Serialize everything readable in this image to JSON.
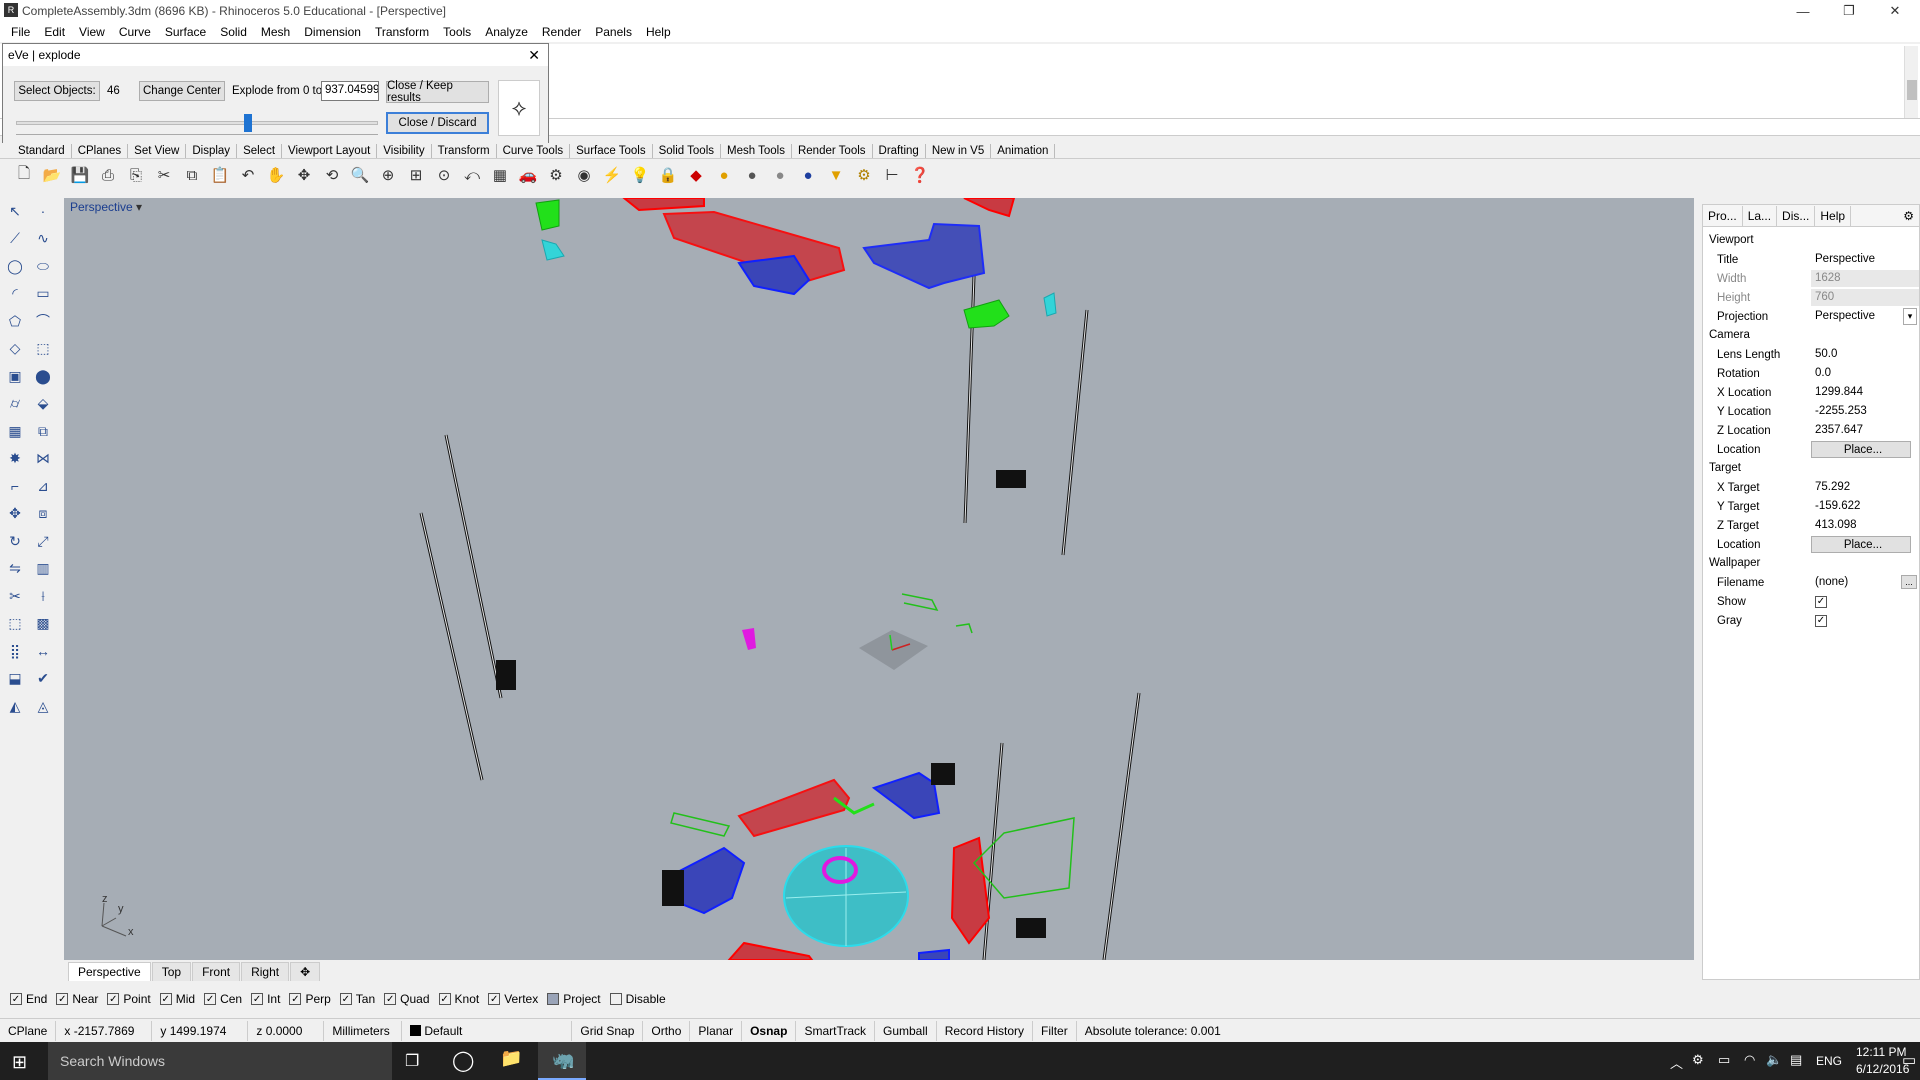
{
  "window": {
    "title": "CompleteAssembly.3dm (8696 KB) - Rhinoceros 5.0 Educational - [Perspective]",
    "minimize": "—",
    "maximize": "❐",
    "close": "✕"
  },
  "menu": [
    "File",
    "Edit",
    "View",
    "Curve",
    "Surface",
    "Solid",
    "Mesh",
    "Dimension",
    "Transform",
    "Tools",
    "Analyze",
    "Render",
    "Panels",
    "Help"
  ],
  "dialog": {
    "title": "eVe | explode",
    "select_objects": "Select Objects:",
    "count": "46",
    "change_center": "Change Center",
    "explode_label": "Explode from 0 to",
    "explode_value": "937.04599",
    "close_keep": "Close / Keep results",
    "close_discard": "Close / Discard",
    "slider_position": 0.64
  },
  "tool_tabs": [
    "Standard",
    "CPlanes",
    "Set View",
    "Display",
    "Select",
    "Viewport Layout",
    "Visibility",
    "Transform",
    "Curve Tools",
    "Surface Tools",
    "Solid Tools",
    "Mesh Tools",
    "Render Tools",
    "Drafting",
    "New in V5",
    "Animation"
  ],
  "viewport": {
    "label": "Perspective",
    "axis_z": "z",
    "axis_y": "y",
    "axis_x": "x"
  },
  "viewport_tabs": [
    "Perspective",
    "Top",
    "Front",
    "Right",
    "✥"
  ],
  "panel": {
    "tabs": [
      "Pro...",
      "La...",
      "Dis...",
      "Help"
    ],
    "viewport_section": "Viewport",
    "title_k": "Title",
    "title_v": "Perspective",
    "width_k": "Width",
    "width_v": "1628",
    "height_k": "Height",
    "height_v": "760",
    "projection_k": "Projection",
    "projection_v": "Perspective",
    "camera_section": "Camera",
    "lens_k": "Lens Length",
    "lens_v": "50.0",
    "rotation_k": "Rotation",
    "rotation_v": "0.0",
    "xloc_k": "X Location",
    "xloc_v": "1299.844",
    "yloc_k": "Y Location",
    "yloc_v": "-2255.253",
    "zloc_k": "Z Location",
    "zloc_v": "2357.647",
    "loc_k": "Location",
    "place": "Place...",
    "target_section": "Target",
    "xt_k": "X Target",
    "xt_v": "75.292",
    "yt_k": "Y Target",
    "yt_v": "-159.622",
    "zt_k": "Z Target",
    "zt_v": "413.098",
    "wallpaper_section": "Wallpaper",
    "filename_k": "Filename",
    "filename_v": "(none)",
    "show_k": "Show",
    "gray_k": "Gray",
    "browse": "..."
  },
  "osnap": [
    "End",
    "Near",
    "Point",
    "Mid",
    "Cen",
    "Int",
    "Perp",
    "Tan",
    "Quad",
    "Knot",
    "Vertex",
    "Project",
    "Disable"
  ],
  "status": {
    "cplane": "CPlane",
    "x": "x -2157.7869",
    "y": "y 1499.1974",
    "z": "z 0.0000",
    "units": "Millimeters",
    "layer": "Default",
    "grid_snap": "Grid Snap",
    "ortho": "Ortho",
    "planar": "Planar",
    "osnap": "Osnap",
    "smarttrack": "SmartTrack",
    "gumball": "Gumball",
    "record_history": "Record History",
    "filter": "Filter",
    "tolerance": "Absolute tolerance: 0.001"
  },
  "taskbar": {
    "search": "Search Windows",
    "time": "12:11 PM",
    "date": "6/12/2016",
    "lang": "ENG"
  },
  "colors": {
    "viewport_bg": "#a6adb5",
    "red": "#e0161a",
    "blue": "#1c28c8",
    "green": "#22e01a",
    "cyan": "#33d4d8",
    "magenta": "#e01ae0"
  }
}
